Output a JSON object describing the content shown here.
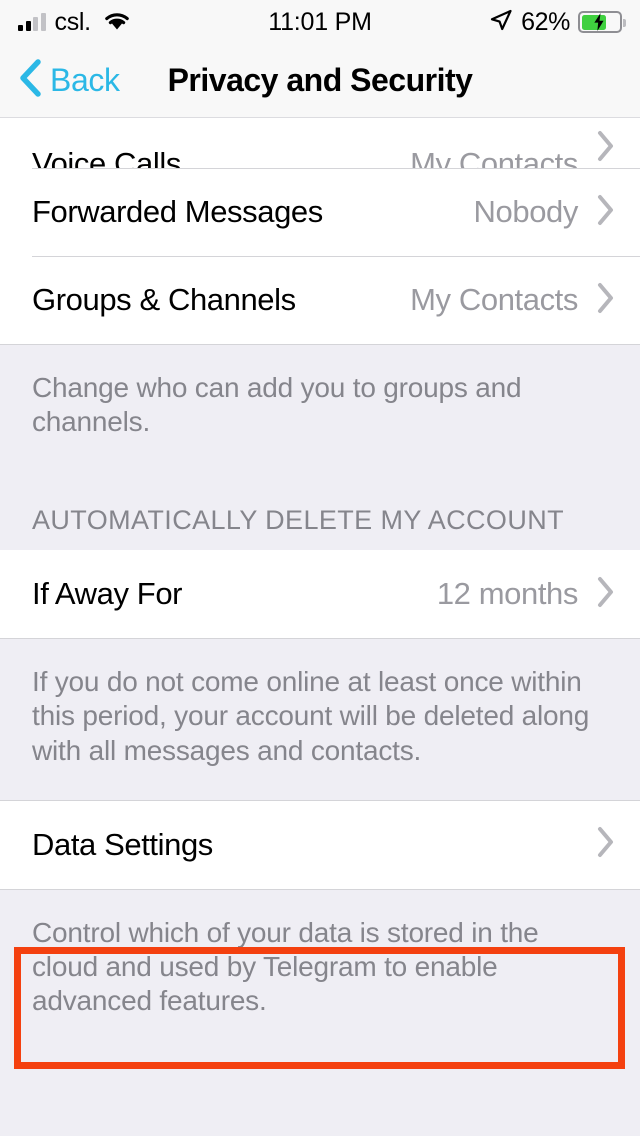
{
  "status_bar": {
    "carrier": "csl.",
    "signal_icon": "signal-bars-icon",
    "signal_bars_filled": 2,
    "signal_bars_total": 4,
    "wifi_icon": "wifi-icon",
    "time": "11:01 PM",
    "location_icon": "location-arrow-icon",
    "battery_percent": "62%",
    "battery_level": 62,
    "battery_icon": "battery-charging-icon",
    "charging": true,
    "battery_color": "#3fd03f"
  },
  "nav_bar": {
    "back_icon": "chevron-left-icon",
    "back_label": "Back",
    "title": "Privacy and Security",
    "accent_color": "#2bb8e6"
  },
  "sections": [
    {
      "rows": [
        {
          "title": "Voice Calls",
          "value": "My Contacts",
          "accessory": "chevron-right-icon",
          "clipped": true
        },
        {
          "title": "Forwarded Messages",
          "value": "Nobody",
          "accessory": "chevron-right-icon"
        },
        {
          "title": "Groups & Channels",
          "value": "My Contacts",
          "accessory": "chevron-right-icon"
        }
      ],
      "footer": "Change who can add you to groups and channels."
    },
    {
      "header": "AUTOMATICALLY DELETE MY ACCOUNT",
      "rows": [
        {
          "title": "If Away For",
          "value": "12 months",
          "accessory": "chevron-right-icon"
        }
      ],
      "footer": "If you do not come online at least once within this period, your account will be deleted along with all messages and contacts."
    },
    {
      "rows": [
        {
          "title": "Data Settings",
          "value": "",
          "accessory": "chevron-right-icon",
          "highlighted": true
        }
      ],
      "footer": "Control which of your data is stored in the cloud and used by Telegram to enable advanced features."
    }
  ],
  "annotation": {
    "target": "Data Settings",
    "color": "#f4400f",
    "shape": "rectangle-outline"
  }
}
